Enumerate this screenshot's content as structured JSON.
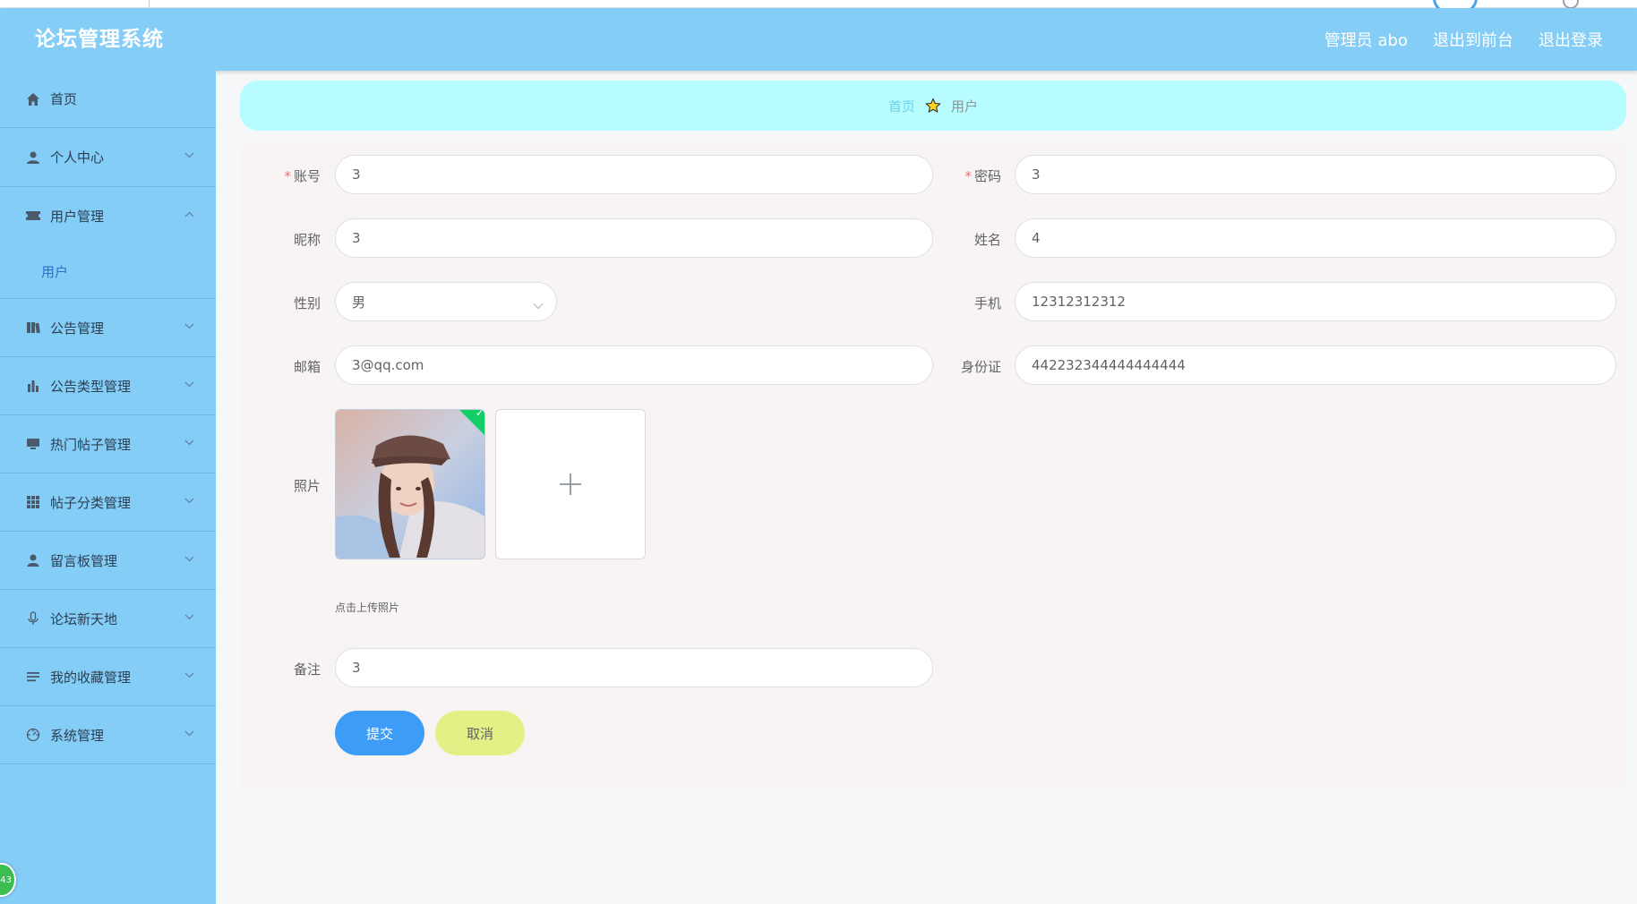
{
  "header": {
    "brand": "论坛管理系统",
    "admin_label": "管理员 abo",
    "exit_front": "退出到前台",
    "logout": "退出登录"
  },
  "sidebar": {
    "items": [
      {
        "label": "首页",
        "icon": "home-icon"
      },
      {
        "label": "个人中心",
        "icon": "user-icon"
      },
      {
        "label": "用户管理",
        "icon": "ticket-icon",
        "expanded": true,
        "children": [
          {
            "label": "用户"
          }
        ]
      },
      {
        "label": "公告管理",
        "icon": "book-icon"
      },
      {
        "label": "公告类型管理",
        "icon": "bar-chart-icon"
      },
      {
        "label": "热门帖子管理",
        "icon": "monitor-icon"
      },
      {
        "label": "帖子分类管理",
        "icon": "grid-icon"
      },
      {
        "label": "留言板管理",
        "icon": "person-icon"
      },
      {
        "label": "论坛新天地",
        "icon": "microphone-icon"
      },
      {
        "label": "我的收藏管理",
        "icon": "list-icon"
      },
      {
        "label": "系统管理",
        "icon": "dashboard-icon"
      }
    ],
    "badge": "43"
  },
  "breadcrumb": {
    "home": "首页",
    "current": "用户"
  },
  "form": {
    "account": {
      "label": "账号",
      "value": "3"
    },
    "password": {
      "label": "密码",
      "value": "3"
    },
    "nickname": {
      "label": "昵称",
      "value": "3"
    },
    "name": {
      "label": "姓名",
      "value": "4"
    },
    "gender": {
      "label": "性别",
      "value": "男"
    },
    "phone": {
      "label": "手机",
      "value": "12312312312"
    },
    "email": {
      "label": "邮箱",
      "value": "3@qq.com"
    },
    "idcard": {
      "label": "身份证",
      "value": "442232344444444444"
    },
    "photo": {
      "label": "照片",
      "tip": "点击上传照片"
    },
    "remark": {
      "label": "备注",
      "value": "3"
    },
    "submit": "提交",
    "cancel": "取消"
  },
  "colors": {
    "header_bg": "#84cdf7",
    "sidebar_bg": "#84cdf7",
    "breadcrumb_bg": "#b7fcff",
    "submit_bg": "#3d9cf5",
    "cancel_bg": "#e3f086",
    "required": "#f56c6c"
  }
}
